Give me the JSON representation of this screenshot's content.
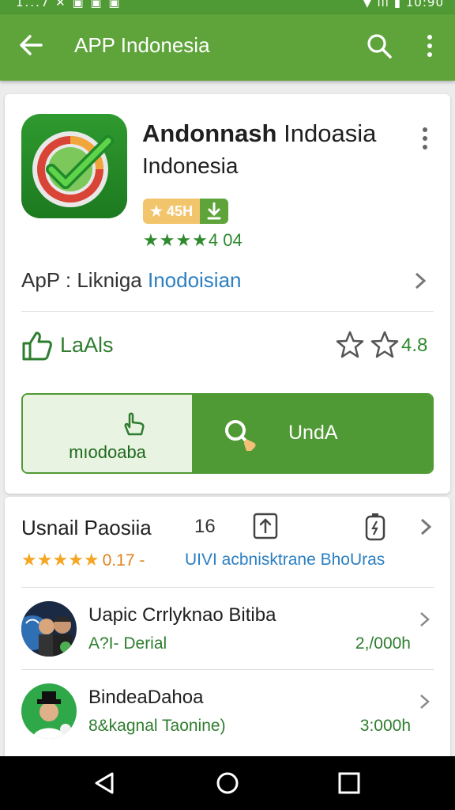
{
  "status_bar": {
    "left_text": "1...7 ✕ ▣ ▣ ▣",
    "right_text": "▼ ıll ▮ 10:90"
  },
  "app_bar": {
    "title": "APP Indonesia",
    "icons": [
      "back-arrow-icon",
      "search-icon",
      "more-vert-icon"
    ]
  },
  "app": {
    "name_bold": "Andonnash",
    "name_rest": " Indoasia",
    "name_line2": "Indonesia",
    "badge_rating": "★ 45H",
    "rating_text": "4 04",
    "crumb_prefix": "ApP : Likniga ",
    "crumb_link": "Inodoisian",
    "likes_label": "LaAls",
    "rating_value": "4.8",
    "install_label": "mıodoaba",
    "open_label": "UndA",
    "colors": {
      "accent": "#5ea43a",
      "accent_dark": "#4f9a34",
      "link": "#2c7fc1",
      "star": "#f5a623"
    }
  },
  "section": {
    "title": "Usnail Paosiia",
    "count": "16",
    "stars_score": "0.17 -",
    "developer": "UIVI acbnisktrane BhoUras"
  },
  "list": [
    {
      "title": "Uapic Crrlyknao Bitiba",
      "subtitle": "A?I- Derial",
      "size": "2,/000h"
    },
    {
      "title": "BindeaDahoa",
      "subtitle": "8&kagnal Taonine)",
      "size": "3:000h"
    }
  ]
}
